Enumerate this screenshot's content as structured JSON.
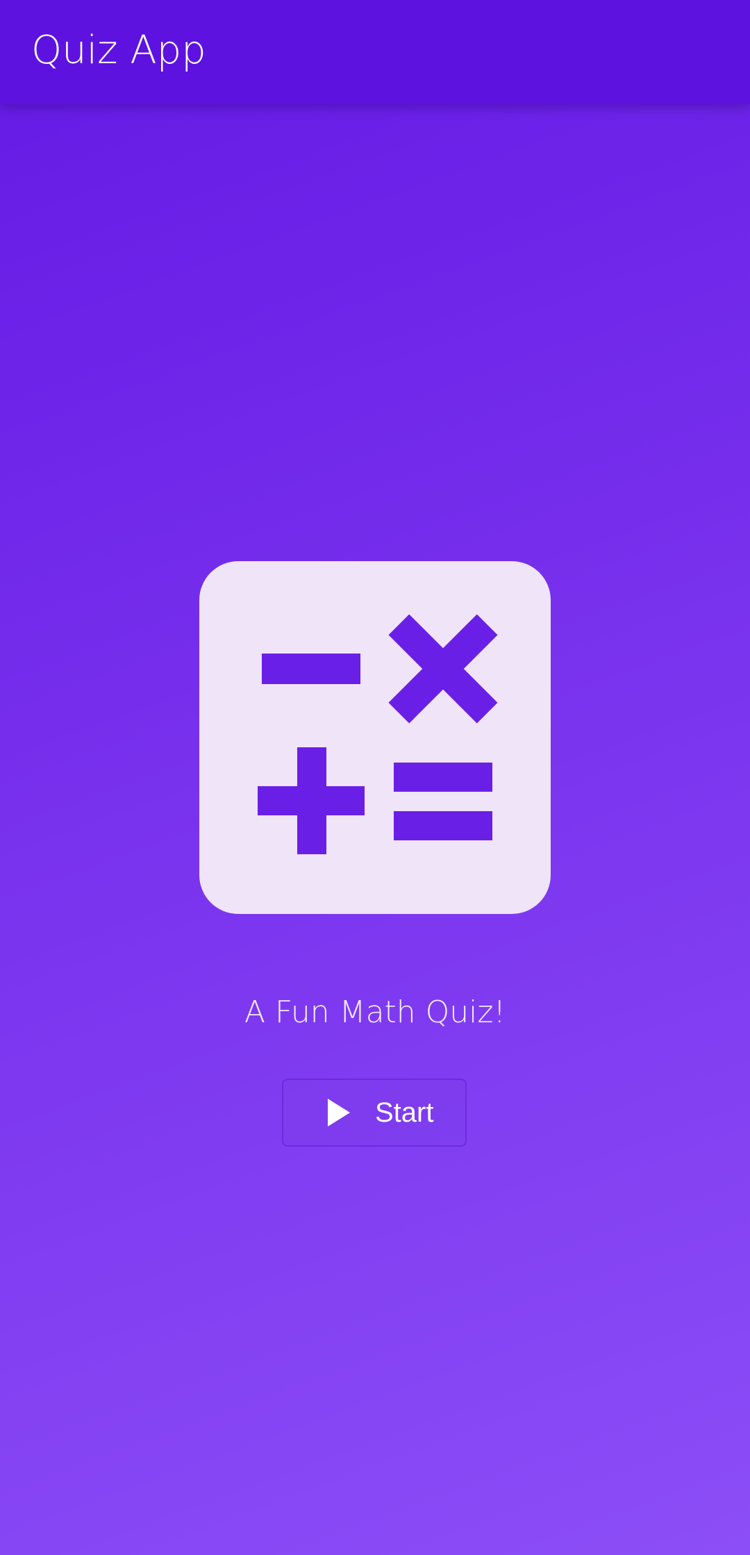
{
  "app_bar": {
    "title": "Quiz App"
  },
  "logo": {
    "icon": "calculator-operators-icon",
    "card_color": "#efe4f8",
    "symbol_color": "#6a1fe6"
  },
  "main": {
    "subtitle": "A Fun Math Quiz!",
    "start_button": {
      "label": "Start",
      "icon": "play-icon"
    }
  },
  "colors": {
    "app_bar": "#5e12e0",
    "background_top": "#6519e4",
    "background_bottom": "#8c4ef7",
    "text": "#ffffff"
  }
}
